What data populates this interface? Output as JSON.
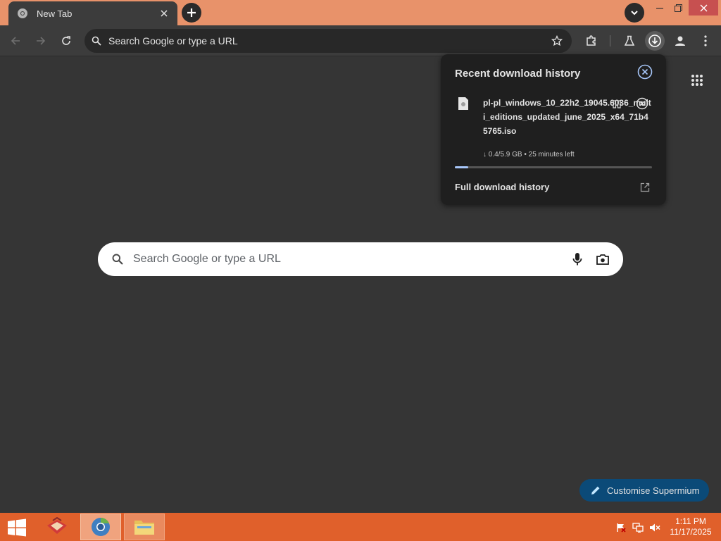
{
  "browser": {
    "tab_title": "New Tab",
    "omnibox_placeholder": "Search Google or type a URL"
  },
  "download_bubble": {
    "title": "Recent download history",
    "items": [
      {
        "filename": "pl-pl_windows_10_22h2_19045.6036_multi_editions_updated_june_2025_x64_71b45765.iso",
        "status": "↓ 0.4/5.9 GB • 25 minutes left",
        "progress_fraction": 0.068
      }
    ],
    "full_history_label": "Full download history"
  },
  "ntp": {
    "search_placeholder": "Search Google or type a URL",
    "customise_label": "Customise Supermium"
  },
  "taskbar": {
    "time": "1:11 PM",
    "date": "11/17/2025"
  },
  "colors": {
    "titlebar": "#e8926a",
    "toolbar": "#3c3c3c",
    "page_background": "#353535",
    "bubble_background": "#1f1f1f",
    "progress": "#a8c7fa",
    "customise_button": "#0b4a78",
    "taskbar": "#e0602b"
  },
  "icons": [
    "chrome-favicon",
    "close-icon",
    "plus-icon",
    "chevron-down-icon",
    "minimize-icon",
    "restore-icon",
    "back-arrow-icon",
    "forward-arrow-icon",
    "reload-icon",
    "search-icon",
    "star-icon",
    "extensions-puzzle-icon",
    "labs-flask-icon",
    "download-icon",
    "profile-icon",
    "more-vertical-icon",
    "apps-grid-icon",
    "pause-icon",
    "cancel-circle-icon",
    "open-external-icon",
    "microphone-icon",
    "camera-lens-icon",
    "pencil-icon",
    "windows-logo-icon",
    "flag-icon",
    "network-icon",
    "volume-mute-icon"
  ]
}
